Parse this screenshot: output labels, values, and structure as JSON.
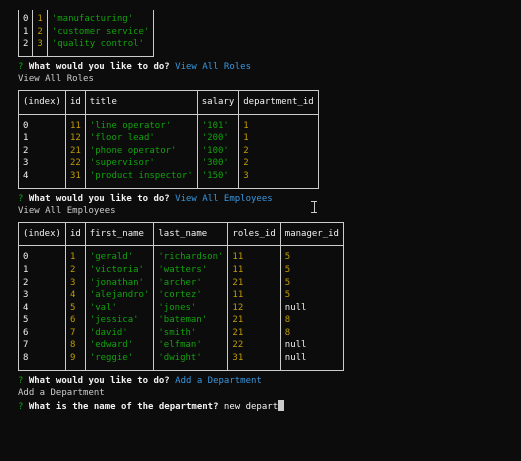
{
  "departments_table": {
    "rows": [
      {
        "index": "0",
        "id": "1",
        "name": "'manufacturing'"
      },
      {
        "index": "1",
        "id": "2",
        "name": "'customer service'"
      },
      {
        "index": "2",
        "id": "3",
        "name": "'quality control'"
      }
    ]
  },
  "prompt1": {
    "qmark": "?",
    "question": "What would you like to do?",
    "answer": "View All Roles",
    "echo": "View All Roles"
  },
  "roles_table": {
    "headers": [
      "(index)",
      "id",
      "title",
      "salary",
      "department_id"
    ],
    "rows": [
      {
        "index": "0",
        "id": "11",
        "title": "'line operator'",
        "salary": "'101'",
        "department_id": "1"
      },
      {
        "index": "1",
        "id": "12",
        "title": "'floor lead'",
        "salary": "'200'",
        "department_id": "1"
      },
      {
        "index": "2",
        "id": "21",
        "title": "'phone operator'",
        "salary": "'100'",
        "department_id": "2"
      },
      {
        "index": "3",
        "id": "22",
        "title": "'supervisor'",
        "salary": "'300'",
        "department_id": "2"
      },
      {
        "index": "4",
        "id": "31",
        "title": "'product inspector'",
        "salary": "'150'",
        "department_id": "3"
      }
    ]
  },
  "prompt2": {
    "qmark": "?",
    "question": "What would you like to do?",
    "answer": "View All Employees",
    "echo": "View All Employees"
  },
  "employees_table": {
    "headers": [
      "(index)",
      "id",
      "first_name",
      "last_name",
      "roles_id",
      "manager_id"
    ],
    "rows": [
      {
        "index": "0",
        "id": "1",
        "first_name": "'gerald'",
        "last_name": "'richardson'",
        "roles_id": "11",
        "manager_id": "5"
      },
      {
        "index": "1",
        "id": "2",
        "first_name": "'victoria'",
        "last_name": "'watters'",
        "roles_id": "11",
        "manager_id": "5"
      },
      {
        "index": "2",
        "id": "3",
        "first_name": "'jonathan'",
        "last_name": "'archer'",
        "roles_id": "21",
        "manager_id": "5"
      },
      {
        "index": "3",
        "id": "4",
        "first_name": "'alejandro'",
        "last_name": "'cortez'",
        "roles_id": "11",
        "manager_id": "5"
      },
      {
        "index": "4",
        "id": "5",
        "first_name": "'val'",
        "last_name": "'jones'",
        "roles_id": "12",
        "manager_id": "null"
      },
      {
        "index": "5",
        "id": "6",
        "first_name": "'jessica'",
        "last_name": "'bateman'",
        "roles_id": "21",
        "manager_id": "8"
      },
      {
        "index": "6",
        "id": "7",
        "first_name": "'david'",
        "last_name": "'smith'",
        "roles_id": "21",
        "manager_id": "8"
      },
      {
        "index": "7",
        "id": "8",
        "first_name": "'edward'",
        "last_name": "'elfman'",
        "roles_id": "22",
        "manager_id": "null"
      },
      {
        "index": "8",
        "id": "9",
        "first_name": "'reggie'",
        "last_name": "'dwight'",
        "roles_id": "31",
        "manager_id": "null"
      }
    ]
  },
  "prompt3": {
    "qmark": "?",
    "question": "What would you like to do?",
    "answer": "Add a Department",
    "echo": "Add a Department"
  },
  "prompt4": {
    "qmark": "?",
    "question": "What is the name of the department?",
    "input": "new depart"
  },
  "colors": {
    "background": "#0c0c0c",
    "text": "#cccccc",
    "string": "#13a10e",
    "number": "#c19c00",
    "answer": "#3a96dd"
  }
}
